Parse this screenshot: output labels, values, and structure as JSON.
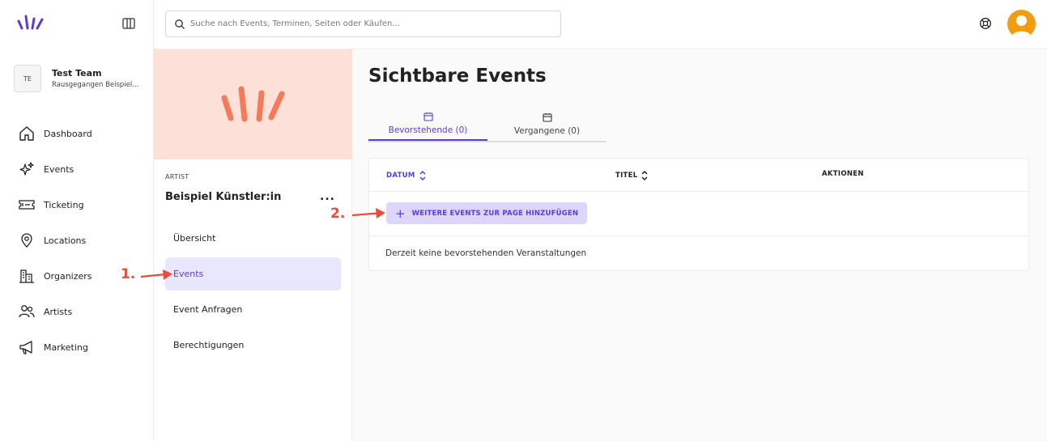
{
  "sidebar": {
    "team": {
      "initials": "TE",
      "name": "Test Team",
      "subtitle": "Rausgegangen Beispiel..."
    },
    "items": [
      {
        "label": "Dashboard",
        "icon": "home-icon"
      },
      {
        "label": "Events",
        "icon": "sparkles-icon"
      },
      {
        "label": "Ticketing",
        "icon": "ticket-icon"
      },
      {
        "label": "Locations",
        "icon": "map-pin-icon"
      },
      {
        "label": "Organizers",
        "icon": "building-icon"
      },
      {
        "label": "Artists",
        "icon": "users-icon"
      },
      {
        "label": "Marketing",
        "icon": "megaphone-icon"
      }
    ]
  },
  "topbar": {
    "search_placeholder": "Suche nach Events, Terminen, Seiten oder Käufen..."
  },
  "artist_panel": {
    "label": "ARTIST",
    "name": "Beispiel Künstler:in",
    "more": "...",
    "nav": [
      {
        "label": "Übersicht",
        "active": false
      },
      {
        "label": "Events",
        "active": true
      },
      {
        "label": "Event Anfragen",
        "active": false
      },
      {
        "label": "Berechtigungen",
        "active": false
      }
    ]
  },
  "main": {
    "title": "Sichtbare Events",
    "tabs": [
      {
        "label": "Bevorstehende (0)",
        "active": true
      },
      {
        "label": "Vergangene (0)",
        "active": false
      }
    ],
    "table": {
      "columns": [
        "DATUM",
        "TITEL",
        "AKTIONEN"
      ],
      "add_button_plus": "+",
      "add_button": "WEITERE EVENTS ZUR PAGE HINZUFÜGEN",
      "empty_message": "Derzeit keine bevorstehenden Veranstaltungen"
    }
  },
  "annotations": {
    "step1": "1.",
    "step2": "2."
  },
  "colors": {
    "accent": "#5b3bdc",
    "annotation": "#e74c3c",
    "banner": "#fde1d8",
    "banner_logo": "#f47a5a"
  }
}
